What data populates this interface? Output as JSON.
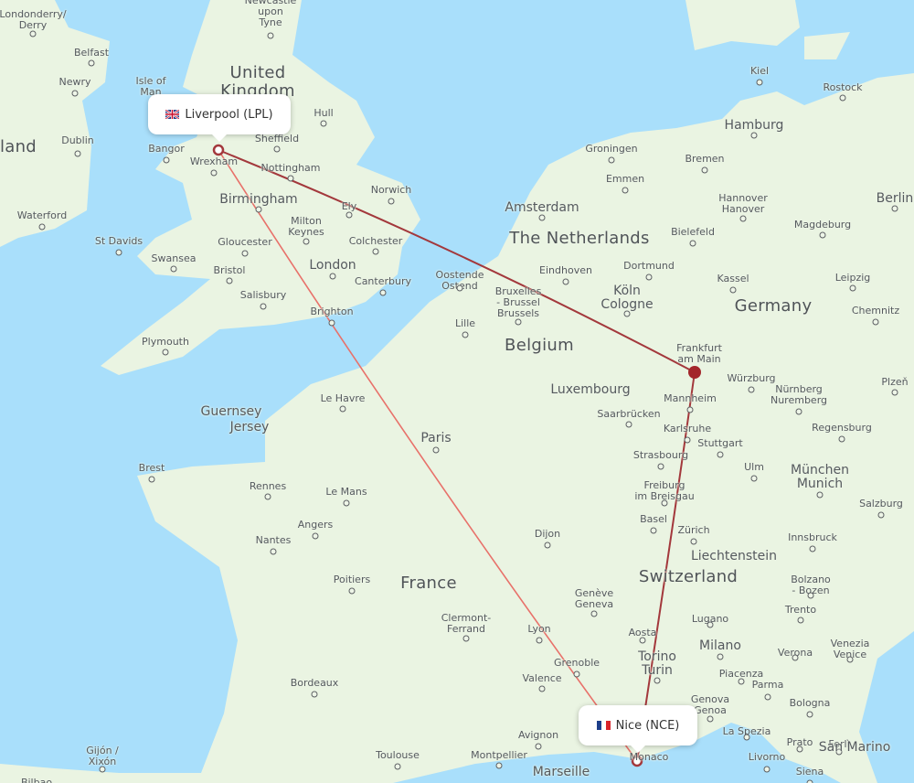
{
  "map": {
    "colors": {
      "water": "#a9dffb",
      "land": "#eaf4e2",
      "route_direct": "#e8716a",
      "route_via": "#a3383c",
      "hub": "#a3262b"
    },
    "origin": {
      "label": "Liverpool (LPL)",
      "flag": "gb-flag"
    },
    "destination": {
      "label": "Nice (NCE)",
      "flag": "fr-flag"
    },
    "hub": {
      "name": "Frankfurt am Main"
    },
    "routes": [
      {
        "id": "direct",
        "from": "LPL",
        "to": "NCE"
      },
      {
        "id": "via-frankfurt",
        "from": "LPL",
        "via": "FRA",
        "to": "NCE"
      }
    ],
    "countries": [
      "United Kingdom",
      "The Netherlands",
      "Belgium",
      "Germany",
      "France",
      "Switzerland",
      "land"
    ],
    "cities": [
      "Londonderry/ Derry",
      "Belfast",
      "Newry",
      "Isle of Man",
      "Dublin",
      "Waterford",
      "Newcastle upon Tyne",
      "Hull",
      "Sheffield",
      "Bangor",
      "Wrexham",
      "Nottingham",
      "Birmingham",
      "Norwich",
      "Ely",
      "Milton Keynes",
      "Colchester",
      "Gloucester",
      "St Davids",
      "Swansea",
      "Bristol",
      "London",
      "Canterbury",
      "Salisbury",
      "Brighton",
      "Plymouth",
      "Guernsey",
      "Jersey",
      "Le Havre",
      "Brest",
      "Rennes",
      "Le Mans",
      "Angers",
      "Nantes",
      "Poitiers",
      "Paris",
      "Bordeaux",
      "Clermont-Ferrand",
      "Lyon",
      "Dijon",
      "Grenoble",
      "Valence",
      "Avignon",
      "Toulouse",
      "Montpellier",
      "Marseille",
      "Monaco",
      "Gijón / Xixón",
      "Bilbao",
      "Oostende Ostend",
      "Lille",
      "Bruxelles - Brussel Brussels",
      "Eindhoven",
      "Amsterdam",
      "Groningen",
      "Emmen",
      "Dortmund",
      "Köln Cologne",
      "Luxembourg",
      "Saarbrücken",
      "Strasbourg",
      "Freiburg im Breisgau",
      "Basel",
      "Zürich",
      "Liechtenstein",
      "Genève Geneva",
      "Aosta",
      "Torino Turin",
      "Milano",
      "Lugano",
      "Genova Genoa",
      "La Spezia",
      "Livorno",
      "Piacenza",
      "Parma",
      "Bologna",
      "Prato",
      "Forlì",
      "San Marino",
      "Siena",
      "Verona",
      "Trento",
      "Bolzano - Bozen",
      "Venezia Venice",
      "Mannheim",
      "Karlsruhe",
      "Stuttgart",
      "Ulm",
      "Würzburg",
      "Nürnberg Nuremberg",
      "Regensburg",
      "München Munich",
      "Salzburg",
      "Innsbruck",
      "Plzeň",
      "Kassel",
      "Bielefeld",
      "Hannover Hanover",
      "Magdeburg",
      "Leipzig",
      "Chemnitz",
      "Berlin",
      "Bremen",
      "Hamburg",
      "Kiel",
      "Rostock"
    ]
  }
}
